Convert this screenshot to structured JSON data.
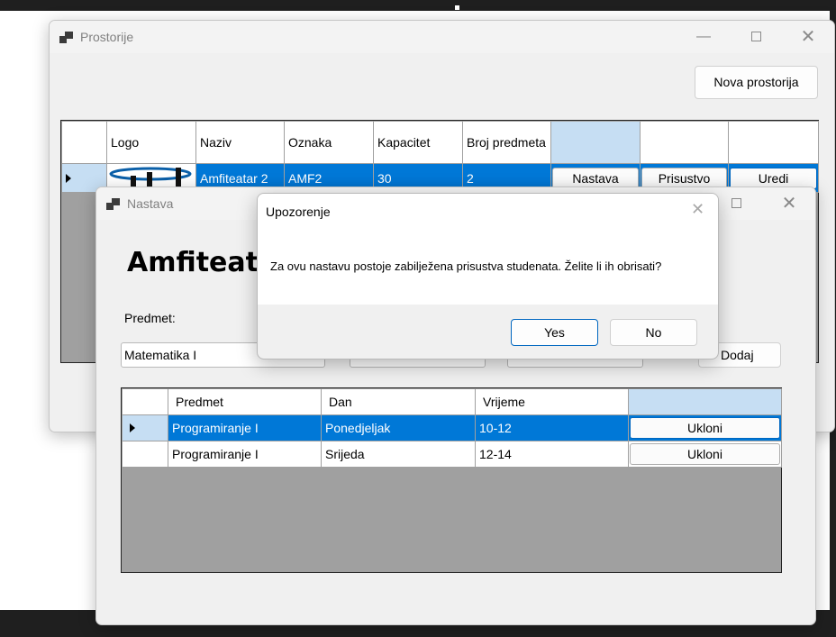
{
  "prostorije": {
    "title": "Prostorije",
    "new_button": "Nova prostorija",
    "columns": [
      "Logo",
      "Naziv",
      "Oznaka",
      "Kapacitet",
      "Broj predmeta"
    ],
    "rows": [
      {
        "naziv": "Amfiteatar 2",
        "oznaka": "AMF2",
        "kapacitet": "30",
        "broj_predmeta": "2",
        "actions": [
          "Nastava",
          "Prisustvo",
          "Uredi"
        ]
      }
    ]
  },
  "nastava": {
    "title": "Nastava",
    "heading": "Amfiteatar",
    "predmet_label": "Predmet:",
    "predmet_value": "Matematika I",
    "add_button": "Dodaj",
    "columns": [
      "Predmet",
      "Dan",
      "Vrijeme"
    ],
    "rows": [
      {
        "predmet": "Programiranje I",
        "dan": "Ponedjeljak",
        "vrijeme": "10-12",
        "action": "Ukloni"
      },
      {
        "predmet": "Programiranje I",
        "dan": "Srijeda",
        "vrijeme": "12-14",
        "action": "Ukloni"
      }
    ]
  },
  "dialog": {
    "title": "Upozorenje",
    "message": "Za ovu nastavu postoje zabilježena prisustva studenata. Želite li ih obrisati?",
    "yes": "Yes",
    "no": "No"
  },
  "colors": {
    "selection": "#0078d7",
    "grid_empty": "#a0a0a0",
    "accent_border": "#0067c0"
  }
}
